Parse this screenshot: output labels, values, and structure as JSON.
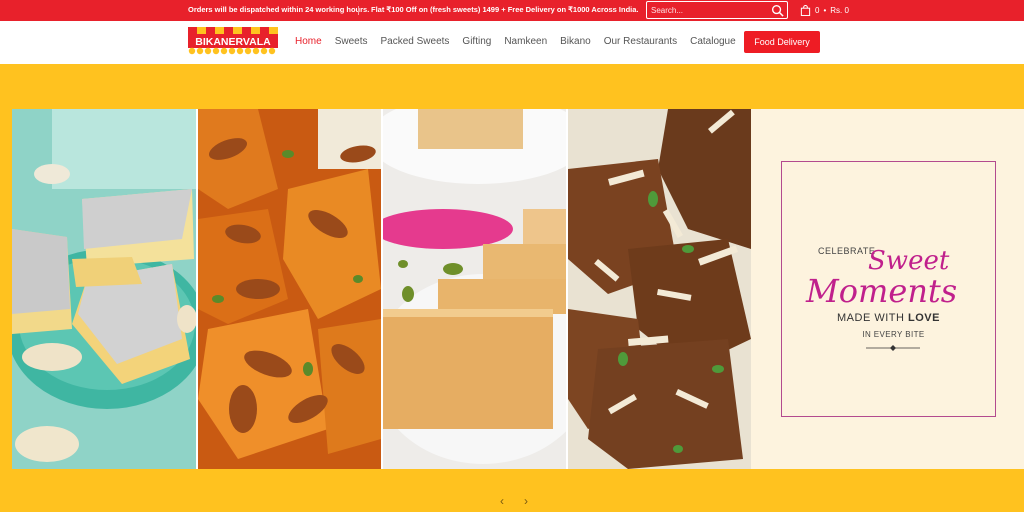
{
  "topbar": {
    "message_1": "Orders will be dispatched within 24 working hours.",
    "message_2": "Flat ₹100 Off on (fresh sweets) 1499 + Free Delivery on ₹1000 Across India.",
    "search_placeholder": "Search...",
    "cart_count": "0",
    "cart_sep": "•",
    "cart_total": "Rs. 0"
  },
  "logo": {
    "text": "BIKANERVALA"
  },
  "nav": {
    "items": [
      "Home",
      "Sweets",
      "Packed Sweets",
      "Gifting",
      "Namkeen",
      "Bikano",
      "Our Restaurants",
      "Catalogue"
    ],
    "cta": "Food Delivery"
  },
  "banner": {
    "line1": "CELEBRATE",
    "line2": "Sweet",
    "line3": "Moments",
    "line4_a": "MADE WITH",
    "line4_b": "LOVE",
    "line5": "IN EVERY BITE"
  },
  "carousel": {
    "prev": "‹",
    "next": "›"
  },
  "colors": {
    "red": "#e8212b",
    "yellow": "#ffc21f",
    "magenta": "#c0208c"
  }
}
